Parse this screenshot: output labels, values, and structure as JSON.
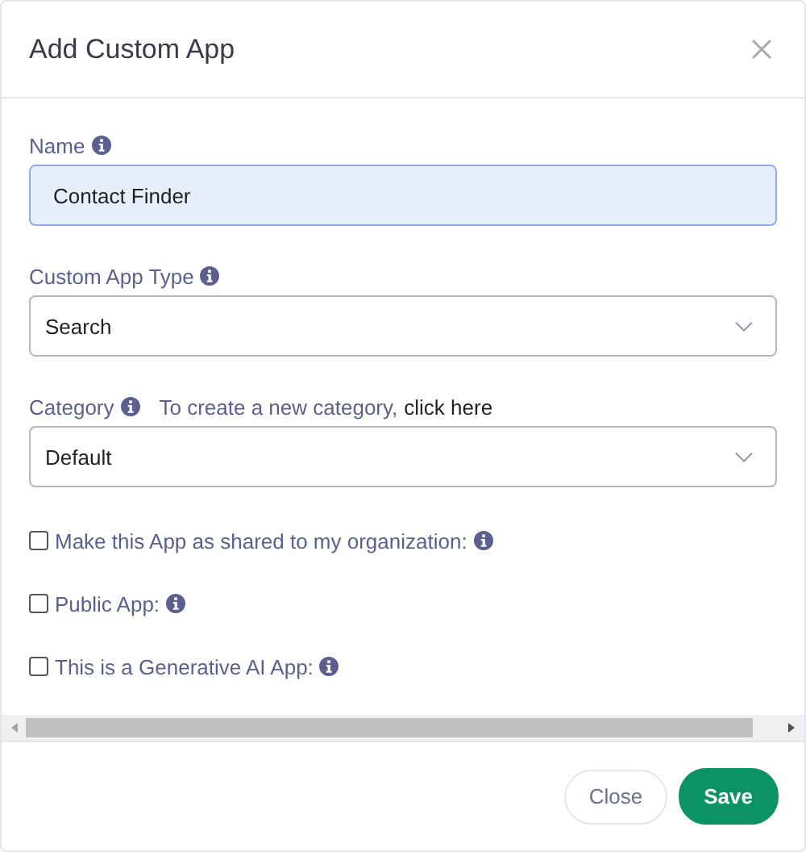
{
  "dialog": {
    "title": "Add Custom App"
  },
  "fields": [
    {
      "kind": "text",
      "label": "Name",
      "value": "Contact Finder",
      "focused": true
    },
    {
      "kind": "select",
      "label": "Custom App Type",
      "value": "Search"
    },
    {
      "kind": "select",
      "label": "Category",
      "value": "Default",
      "hint": "To create a new category,",
      "link": "click here"
    }
  ],
  "checkboxes": [
    {
      "label": "Make this App as shared to my organization:",
      "checked": false
    },
    {
      "label": "Public App:",
      "checked": false
    },
    {
      "label": "This is a Generative AI App:",
      "checked": false
    }
  ],
  "buttons": [
    {
      "kind": "secondary",
      "label": "Close"
    },
    {
      "kind": "primary",
      "label": "Save"
    }
  ]
}
